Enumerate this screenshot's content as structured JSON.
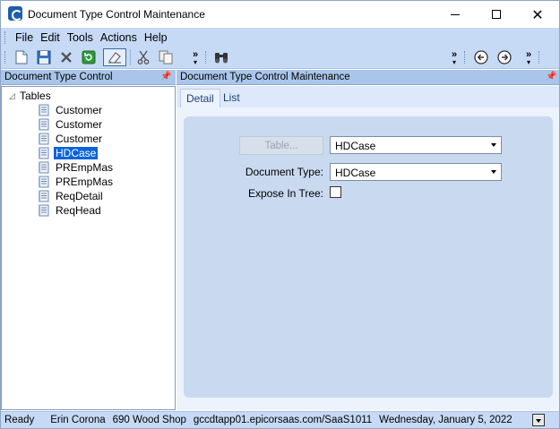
{
  "window": {
    "title": "Document Type Control Maintenance",
    "icon": "epicor-e-icon"
  },
  "menu": {
    "items": [
      "File",
      "Edit",
      "Tools",
      "Actions",
      "Help"
    ]
  },
  "toolbar": {
    "icons": [
      "new-icon",
      "save-icon",
      "delete-icon",
      "refresh-icon",
      "clear-icon",
      "cut-icon",
      "copy-icon",
      "search-icon",
      "back-icon",
      "forward-icon"
    ]
  },
  "left_panel": {
    "title": "Document Type Control",
    "tree": {
      "root_label": "Tables",
      "items": [
        {
          "label": "Customer",
          "selected": false
        },
        {
          "label": "Customer",
          "selected": false
        },
        {
          "label": "Customer",
          "selected": false
        },
        {
          "label": "HDCase",
          "selected": true
        },
        {
          "label": "PREmpMas",
          "selected": false
        },
        {
          "label": "PREmpMas",
          "selected": false
        },
        {
          "label": "ReqDetail",
          "selected": false
        },
        {
          "label": "ReqHead",
          "selected": false
        }
      ]
    }
  },
  "right_panel": {
    "title": "Document Type Control Maintenance",
    "tabs": [
      {
        "label": "Detail",
        "active": true
      },
      {
        "label": "List",
        "active": false
      }
    ],
    "form": {
      "table_button_label": "Table...",
      "table_value": "HDCase",
      "document_type_label": "Document Type:",
      "document_type_value": "HDCase",
      "expose_in_tree_label": "Expose In Tree:",
      "expose_in_tree_checked": false
    }
  },
  "status_bar": {
    "state": "Ready",
    "user": "Erin Corona",
    "company": "690 Wood Shop",
    "server": "gccdtapp01.epicorsaas.com/SaaS1011",
    "date": "Wednesday, January 5, 2022"
  },
  "colors": {
    "band": "#c6daf6",
    "header": "#a9c6ea",
    "selection": "#0a64d8",
    "panel": "#c9d9ef"
  }
}
